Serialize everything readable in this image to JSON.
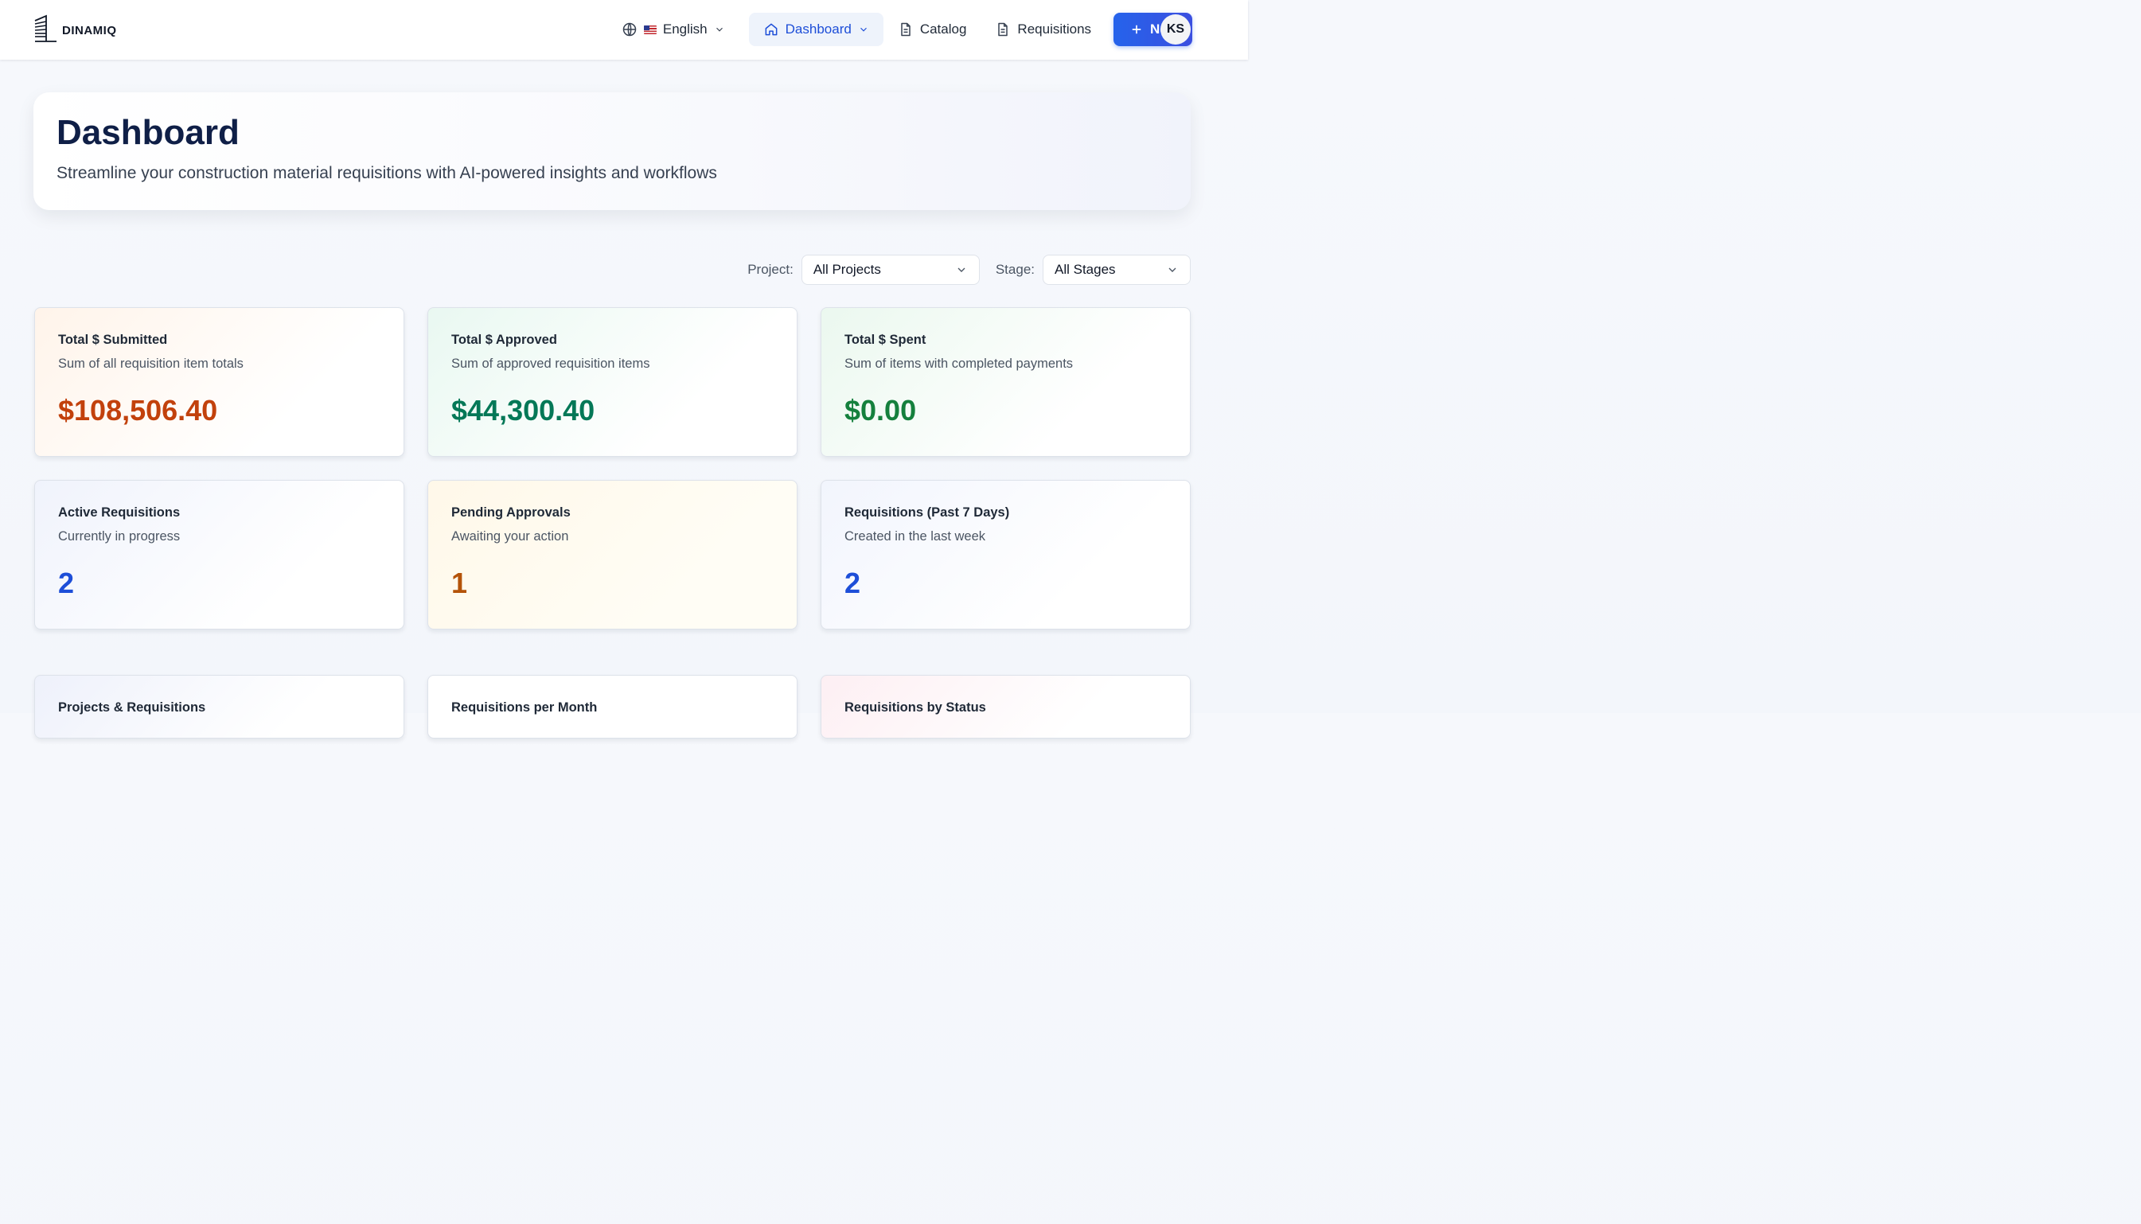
{
  "app": {
    "brand": "DINAMIQ",
    "avatar_initials": "KS"
  },
  "nav": {
    "language": "English",
    "dashboard": "Dashboard",
    "catalog": "Catalog",
    "requisitions": "Requisitions",
    "new_button": "New"
  },
  "hero": {
    "title": "Dashboard",
    "subtitle": "Streamline your construction material requisitions with AI-powered insights and workflows"
  },
  "filters": {
    "project_label": "Project:",
    "project_value": "All Projects",
    "stage_label": "Stage:",
    "stage_value": "All Stages"
  },
  "stats": [
    {
      "title": "Total $ Submitted",
      "subtitle": "Sum of all requisition item totals",
      "value": "$108,506.40",
      "color": "#c2410c"
    },
    {
      "title": "Total $ Approved",
      "subtitle": "Sum of approved requisition items",
      "value": "$44,300.40",
      "color": "#047857"
    },
    {
      "title": "Total $ Spent",
      "subtitle": "Sum of items with completed payments",
      "value": "$0.00",
      "color": "#15803d"
    },
    {
      "title": "Active Requisitions",
      "subtitle": "Currently in progress",
      "value": "2",
      "color": "#1d4ed8"
    },
    {
      "title": "Pending Approvals",
      "subtitle": "Awaiting your action",
      "value": "1",
      "color": "#b45309"
    },
    {
      "title": "Requisitions (Past 7 Days)",
      "subtitle": "Created in the last week",
      "value": "2",
      "color": "#1d4ed8"
    }
  ],
  "bottom_cards": [
    {
      "title": "Projects & Requisitions"
    },
    {
      "title": "Requisitions per Month"
    },
    {
      "title": "Requisitions by Status"
    }
  ],
  "colors": {
    "accent": "#2563eb",
    "nav_active_bg": "#eef3fb",
    "title": "#0f1f47"
  }
}
